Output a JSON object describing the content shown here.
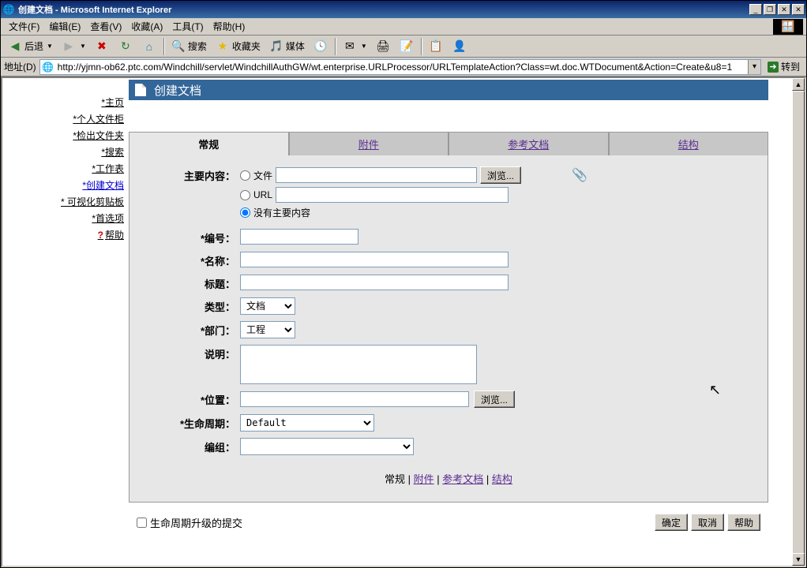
{
  "window": {
    "title": "创建文档 - Microsoft Internet Explorer"
  },
  "menu": {
    "file": "文件(F)",
    "edit": "编辑(E)",
    "view": "查看(V)",
    "favorites": "收藏(A)",
    "tools": "工具(T)",
    "help": "帮助(H)"
  },
  "toolbar": {
    "back": "后退",
    "search": "搜索",
    "favorites": "收藏夹",
    "media": "媒体"
  },
  "address": {
    "label": "地址(D)",
    "url": "http://yjmn-ob62.ptc.com/Windchill/servlet/WindchillAuthGW/wt.enterprise.URLProcessor/URLTemplateAction?Class=wt.doc.WTDocument&Action=Create&u8=1",
    "go": "转到"
  },
  "sidenav": {
    "items": [
      "*主页",
      "*个人文件柜",
      "*检出文件夹",
      "*搜索",
      "*工作表",
      "*创建文档",
      "* 可视化剪贴板",
      "*首选项"
    ],
    "help": "帮助"
  },
  "page": {
    "title": "创建文档",
    "tabs": {
      "general": "常规",
      "attachment": "附件",
      "refdoc": "参考文档",
      "structure": "结构"
    },
    "labels": {
      "primaryContent": "主要内容：",
      "file": "文件",
      "url": "URL",
      "none": "没有主要内容",
      "browse": "浏览...",
      "number": "*编号：",
      "name": "*名称：",
      "title_f": "标题：",
      "type": "类型：",
      "dept": "*部门：",
      "desc": "说明：",
      "location": "*位置：",
      "lifecycle": "*生命周期：",
      "group": "编组："
    },
    "typeOptions": [
      "文档"
    ],
    "deptOptions": [
      "工程"
    ],
    "lifecycleOptions": [
      "Default"
    ],
    "bottom": {
      "general": "常规",
      "attachment": "附件",
      "refdoc": "参考文档",
      "structure": "结构"
    },
    "footer": {
      "checkbox": "生命周期升级的提交",
      "ok": "确定",
      "cancel": "取消",
      "help": "帮助"
    }
  }
}
